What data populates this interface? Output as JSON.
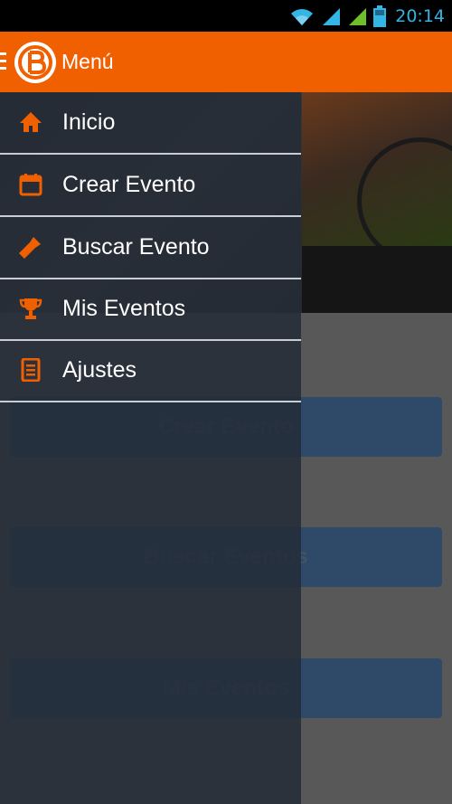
{
  "status_bar": {
    "time": "20:14",
    "icons": [
      "wifi-icon",
      "signal-icon",
      "signal-icon-2",
      "battery-icon"
    ]
  },
  "action_bar": {
    "title": "Menú",
    "logo": "app-logo"
  },
  "drawer": {
    "items": [
      {
        "label": "Inicio",
        "icon": "home-icon"
      },
      {
        "label": "Crear Evento",
        "icon": "calendar-icon"
      },
      {
        "label": "Buscar Evento",
        "icon": "flashlight-icon"
      },
      {
        "label": "Mis Eventos",
        "icon": "trophy-icon"
      },
      {
        "label": "Ajustes",
        "icon": "list-icon"
      }
    ]
  },
  "main": {
    "buttons": [
      {
        "label": "Crear Evento"
      },
      {
        "label": "Buscar Eventos"
      },
      {
        "label": "Mis Eventos"
      }
    ]
  },
  "colors": {
    "accent": "#f06000",
    "status_text": "#33b5e5",
    "button_bg": "#2f4a68",
    "drawer_bg": "#242c38"
  }
}
